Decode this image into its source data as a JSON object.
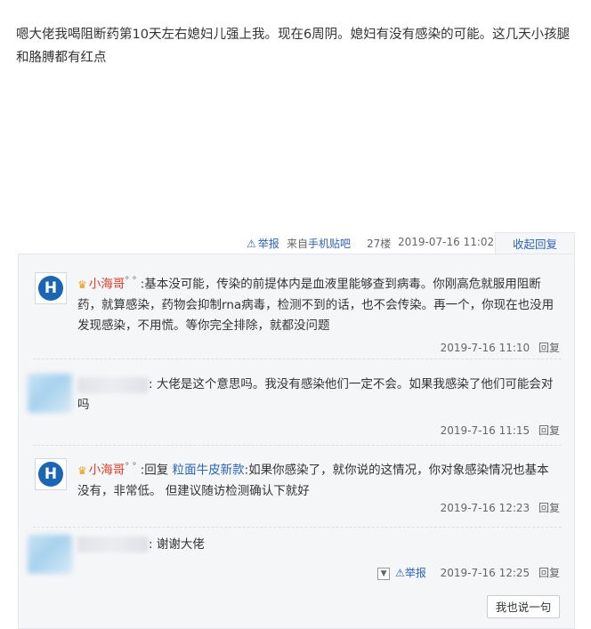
{
  "post": {
    "text": "嗯大佬我喝阻断药第10天左右媳妇儿强上我。现在6周阴。媳妇有没有感染的可能。这几天小孩腿和胳膊都有红点",
    "report_label": "举报",
    "from_prefix": "来自",
    "from_link": "手机贴吧",
    "floor": "27楼",
    "time": "2019-07-16 11:02",
    "collapse_label": "收起回复"
  },
  "replies": [
    {
      "username": "小海哥",
      "badge": "° °",
      "text": ":基本没可能，传染的前提体内是血液里能够查到病毒。你刚高危就服用阻断药，就算感染，药物会抑制rna病毒，检测不到的话，也不会传染。再一个，你现在也没用发现感染，不用慌。等你完全排除，就都没问题",
      "time": "2019-7-16 11:10",
      "reply_label": "回复"
    },
    {
      "username": "",
      "text": ": 大佬是这个意思吗。我没有感染他们一定不会。如果我感染了他们可能会对吗",
      "time": "2019-7-16 11:15",
      "reply_label": "回复"
    },
    {
      "username": "小海哥",
      "badge": "° °",
      "reply_prefix": ":回复",
      "reply_to": "粒面牛皮新款",
      "text": ":如果你感染了，就你说的这情况，你对象感染情况也基本没有，非常低。 但建议随访检测确认下就好",
      "time": "2019-7-16 12:23",
      "reply_label": "回复"
    },
    {
      "username": "",
      "text": ": 谢谢大佬",
      "report_label": "举报",
      "time": "2019-7-16 12:25",
      "reply_label": "回复"
    }
  ],
  "say_button": "我也说一句",
  "colors": {
    "link": "#2d64b3",
    "username": "#e03c2a",
    "panel_bg": "#f5f6f8",
    "avatar_blue": "#1a66b5"
  }
}
